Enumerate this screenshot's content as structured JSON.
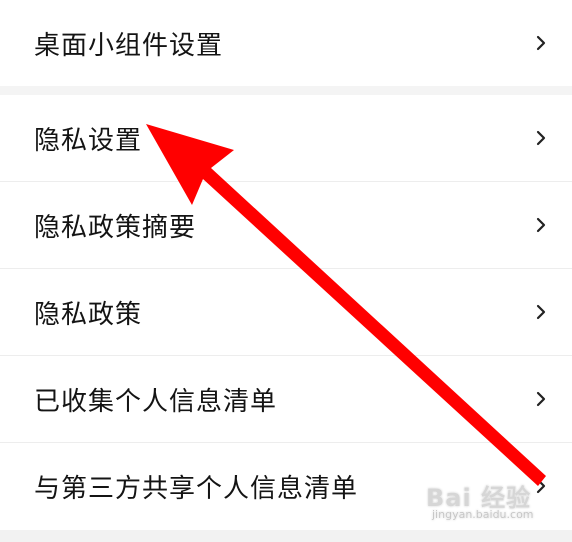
{
  "settings": {
    "items": [
      {
        "label": "桌面小组件设置"
      },
      {
        "label": "隐私设置"
      },
      {
        "label": "隐私政策摘要"
      },
      {
        "label": "隐私政策"
      },
      {
        "label": "已收集个人信息清单"
      },
      {
        "label": "与第三方共享个人信息清单"
      }
    ]
  },
  "annotation": {
    "arrow_color": "#ff0000"
  },
  "watermark": {
    "main": "Bai 经验",
    "sub": "jingyan.baidu.com"
  },
  "colors": {
    "background": "#f4f4f4",
    "row_background": "#ffffff",
    "text": "#141414",
    "chevron": "#222222"
  }
}
